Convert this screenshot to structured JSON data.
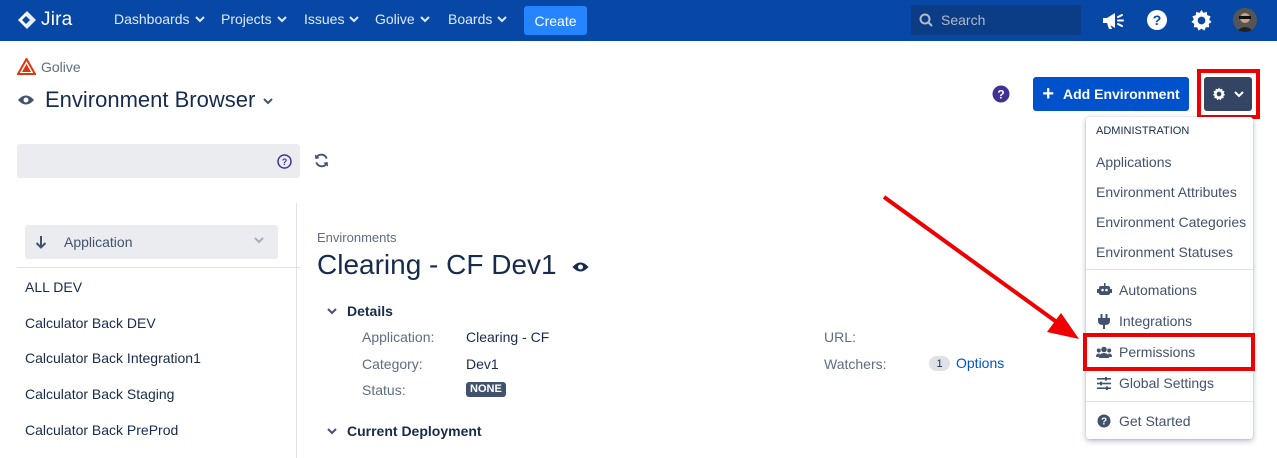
{
  "topnav": {
    "logo_text": "Jira",
    "items": [
      {
        "label": "Dashboards"
      },
      {
        "label": "Projects"
      },
      {
        "label": "Issues"
      },
      {
        "label": "Golive"
      },
      {
        "label": "Boards"
      }
    ],
    "create_label": "Create",
    "search_placeholder": "Search",
    "icons": [
      "notifications-megaphone-icon",
      "help-icon",
      "settings-gear-icon",
      "user-avatar"
    ]
  },
  "header": {
    "project_name": "Golive",
    "page_title": "Environment Browser",
    "add_button_label": "Add Environment"
  },
  "admin_menu": {
    "heading": "ADMINISTRATION",
    "items": [
      {
        "label": "Applications"
      },
      {
        "label": "Environment Attributes"
      },
      {
        "label": "Environment Categories"
      },
      {
        "label": "Environment Statuses"
      }
    ],
    "tool_items": [
      {
        "label": "Automations",
        "icon": "robot-icon"
      },
      {
        "label": "Integrations",
        "icon": "plug-icon"
      },
      {
        "label": "Permissions",
        "icon": "users-icon"
      },
      {
        "label": "Global Settings",
        "icon": "sliders-icon"
      }
    ],
    "footer_item": {
      "label": "Get Started",
      "icon": "question-circle-icon"
    }
  },
  "left_panel": {
    "filter_value": "",
    "sort_label": "Application",
    "environments": [
      {
        "label": "ALL DEV"
      },
      {
        "label": "Calculator Back DEV"
      },
      {
        "label": "Calculator Back Integration1"
      },
      {
        "label": "Calculator Back Staging"
      },
      {
        "label": "Calculator Back PreProd"
      }
    ]
  },
  "details": {
    "breadcrumb": "Environments",
    "title": "Clearing - CF Dev1",
    "section_details": "Details",
    "section_current_deployment": "Current Deployment",
    "fields": {
      "application_label": "Application:",
      "application_value": "Clearing - CF",
      "category_label": "Category:",
      "category_value": "Dev1",
      "status_label": "Status:",
      "status_value": "NONE",
      "url_label": "URL:",
      "url_value": "",
      "watchers_label": "Watchers:",
      "watchers_count": "1",
      "watchers_link": "Options"
    }
  },
  "colors": {
    "topbar": "#0747a6",
    "primary_button": "#0052cc",
    "create_button": "#2684ff",
    "annotation_red": "#ee0000",
    "status_lozenge": "#42526e"
  }
}
